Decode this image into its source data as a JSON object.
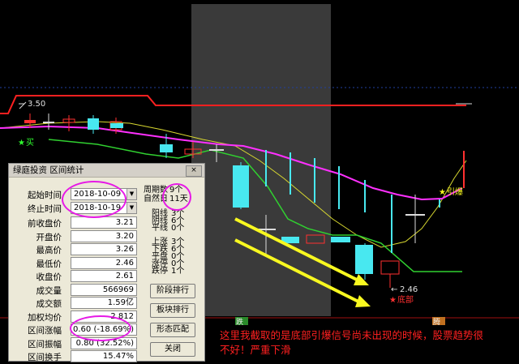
{
  "chart": {
    "price_350": "3.50",
    "low_label": "2.46",
    "buy_label": "买",
    "yinbao_label": "引爆",
    "dibu_label": "底部",
    "bottom_left_label": "跌",
    "bottom_right_label": "腾",
    "colors": {
      "up": "#ff3030",
      "down": "#48e8f0",
      "ma_magenta": "#ff30ff",
      "ma_yellow": "#d8d830",
      "ma_green": "#30d030",
      "arrow": "#f8f820",
      "resistance": "#ff2020"
    }
  },
  "dialog": {
    "title": "绿庭投资 区间统计",
    "close_label": "×",
    "start_label": "起始时间",
    "start_value": "2018-10-09",
    "end_label": "终止时间",
    "end_value": "2018-10-19",
    "rows": [
      {
        "label": "前收盘价",
        "value": "3.21"
      },
      {
        "label": "开盘价",
        "value": "3.20"
      },
      {
        "label": "最高价",
        "value": "3.26"
      },
      {
        "label": "最低价",
        "value": "2.46"
      },
      {
        "label": "收盘价",
        "value": "2.61"
      },
      {
        "label": "成交量",
        "value": "566969"
      },
      {
        "label": "成交额",
        "value": "1.59亿"
      },
      {
        "label": "加权均价",
        "value": "2.812"
      },
      {
        "label": "区间涨幅",
        "value": "0.60 (-18.69%)"
      },
      {
        "label": "区间振幅",
        "value": "0.80 (32.52%)"
      },
      {
        "label": "区间换手",
        "value": "15.47%"
      }
    ],
    "period_label": "周期数",
    "period_value": "9个",
    "natural_label": "自然日",
    "natural_value": "11天",
    "stats1": [
      {
        "label": "阳线",
        "value": "3个"
      },
      {
        "label": "阴线",
        "value": "6个"
      },
      {
        "label": "平线",
        "value": "0个"
      }
    ],
    "stats2": [
      {
        "label": "上涨",
        "value": "3个"
      },
      {
        "label": "下跌",
        "value": "6个"
      },
      {
        "label": "平盘",
        "value": "0个"
      },
      {
        "label": "涨停",
        "value": "0个"
      },
      {
        "label": "跌停",
        "value": "1个"
      }
    ],
    "buttons": [
      "阶段排行",
      "板块排行",
      "形态匹配",
      "关闭"
    ]
  },
  "annotation": {
    "line1": "这里我截取的是底部引爆信号尚未出现的时候，股票趋势很",
    "line2": "不好！严重下滑"
  }
}
